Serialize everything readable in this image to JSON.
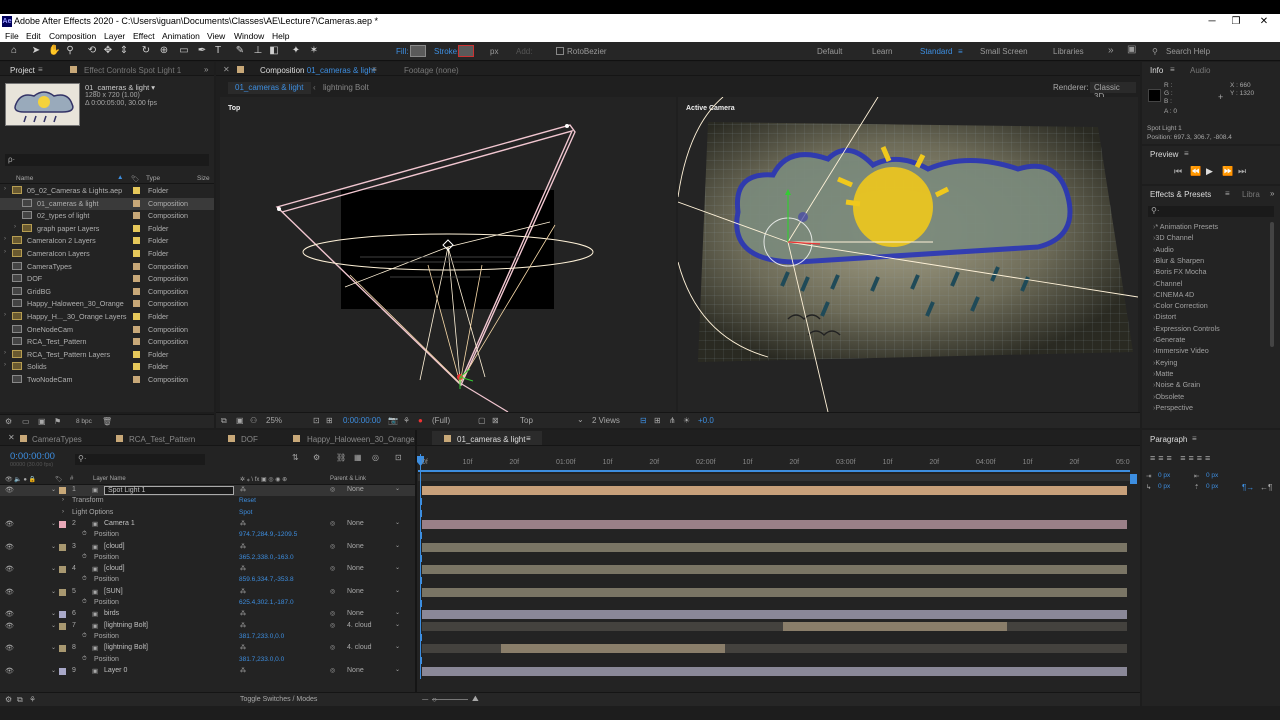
{
  "window": {
    "title": "Adobe After Effects 2020 - C:\\Users\\iguan\\Documents\\Classes\\AE\\Lecture7\\Cameras.aep *"
  },
  "menu": [
    "File",
    "Edit",
    "Composition",
    "Layer",
    "Effect",
    "Animation",
    "View",
    "Window",
    "Help"
  ],
  "toolbar": {
    "fill_label": "Fill:",
    "stroke_label": "Stroke:",
    "px_label": "px",
    "add_label": "Add:",
    "rotobezier": "RotoBezier",
    "workspaces": [
      "Default",
      "Learn",
      "Standard",
      "Small Screen",
      "Libraries"
    ],
    "search_placeholder": "Search Help"
  },
  "project": {
    "tab": "Project",
    "effect_controls_tab": "Effect Controls Spot Light 1",
    "comp_name": "01_cameras & light ▾",
    "comp_info_1": "1280 x 720 (1.00)",
    "comp_info_2": "Δ 0:00:05:00, 30.00 fps",
    "search_placeholder": "ρ·",
    "headers": {
      "name": "Name",
      "type": "Type",
      "size": "Size"
    },
    "items": [
      {
        "name": "05_02_Cameras & Lights.aep",
        "type": "Folder",
        "color": "#e6c85a"
      },
      {
        "name": "01_cameras & light",
        "type": "Composition",
        "color": "#c8a878"
      },
      {
        "name": "02_types of light",
        "type": "Composition",
        "color": "#c8a878"
      },
      {
        "name": "graph paper Layers",
        "type": "Folder",
        "color": "#e6c85a"
      },
      {
        "name": "CameraIcon 2 Layers",
        "type": "Folder",
        "color": "#e6c85a"
      },
      {
        "name": "CameraIcon Layers",
        "type": "Folder",
        "color": "#e6c85a"
      },
      {
        "name": "CameraTypes",
        "type": "Composition",
        "color": "#c8a878"
      },
      {
        "name": "DOF",
        "type": "Composition",
        "color": "#c8a878"
      },
      {
        "name": "GridBG",
        "type": "Composition",
        "color": "#c8a878"
      },
      {
        "name": "Happy_Haloween_30_Orange",
        "type": "Composition",
        "color": "#c8a878"
      },
      {
        "name": "Happy_H..._30_Orange Layers",
        "type": "Folder",
        "color": "#e6c85a"
      },
      {
        "name": "OneNodeCam",
        "type": "Composition",
        "color": "#c8a878"
      },
      {
        "name": "RCA_Test_Pattern",
        "type": "Composition",
        "color": "#c8a878"
      },
      {
        "name": "RCA_Test_Pattern Layers",
        "type": "Folder",
        "color": "#e6c85a"
      },
      {
        "name": "Solids",
        "type": "Folder",
        "color": "#e6c85a"
      },
      {
        "name": "TwoNodeCam",
        "type": "Composition",
        "color": "#c8a878"
      }
    ],
    "bpc": "8 bpc"
  },
  "composition": {
    "tab_prefix": "Composition",
    "tab_name": "01_cameras & light",
    "footage_tab": "Footage (none)",
    "breadcrumbs": [
      "01_cameras & light",
      "lightning Bolt"
    ],
    "renderer_label": "Renderer:",
    "renderer": "Classic 3D",
    "view_left": "Top",
    "view_right": "Active Camera",
    "footer": {
      "zoom": "25%",
      "time": "0:00:00:00",
      "resolution": "(Full)",
      "view": "Top",
      "views": "2 Views",
      "exposure": "+0.0"
    }
  },
  "info": {
    "tab": "Info",
    "audio_tab": "Audio",
    "r": "R :",
    "g": "G :",
    "b": "B :",
    "a": "A : 0",
    "x": "X : 660",
    "y": "Y : 1320",
    "layer": "Spot Light 1",
    "position": "Position: 697.3, 306.7, -808.4"
  },
  "preview": {
    "tab": "Preview"
  },
  "effects": {
    "tab": "Effects & Presets",
    "libraries_tab": "Libra",
    "items": [
      "* Animation Presets",
      "3D Channel",
      "Audio",
      "Blur & Sharpen",
      "Boris FX Mocha",
      "Channel",
      "CINEMA 4D",
      "Color Correction",
      "Distort",
      "Expression Controls",
      "Generate",
      "Immersive Video",
      "Keying",
      "Matte",
      "Noise & Grain",
      "Obsolete",
      "Perspective"
    ]
  },
  "timeline": {
    "tabs": [
      "CameraTypes",
      "RCA_Test_Pattern",
      "DOF",
      "Happy_Haloween_30_Orange",
      "01_cameras & light"
    ],
    "timecode": "0:00:00:00",
    "fps_sub": "00000 (30.00 fps)",
    "col_layer_name": "Layer Name",
    "col_parent": "Parent & Link",
    "ruler": [
      "0f",
      "10f",
      "20f",
      "01:00f",
      "10f",
      "20f",
      "02:00f",
      "10f",
      "20f",
      "03:00f",
      "10f",
      "20f",
      "04:00f",
      "10f",
      "20f",
      "05:0"
    ],
    "toggle_label": "Toggle Switches / Modes",
    "layers": [
      {
        "num": "1",
        "name": "Spot Light 1",
        "kind": "layer",
        "parent": "None",
        "label": "#c8a878",
        "bar": "#c8a07a",
        "start": 0,
        "end": 1,
        "selected": true
      },
      {
        "kind": "prop",
        "name": "Transform",
        "value": "Reset"
      },
      {
        "kind": "prop",
        "name": "Light Options",
        "value": "Spot"
      },
      {
        "num": "2",
        "name": "Camera 1",
        "kind": "layer",
        "parent": "None",
        "label": "#e8a8b8",
        "bar": "#9a8088",
        "start": 0,
        "end": 1
      },
      {
        "kind": "prop",
        "name": "Position",
        "value": "974.7,284.9,-1209.5"
      },
      {
        "num": "3",
        "name": "[cloud]",
        "kind": "layer",
        "parent": "None",
        "label": "#a89870",
        "bar": "#7a7565",
        "start": 0,
        "end": 1
      },
      {
        "kind": "prop",
        "name": "Position",
        "value": "365.2,338.0,-163.0"
      },
      {
        "num": "4",
        "name": "[cloud]",
        "kind": "layer",
        "parent": "None",
        "label": "#a89870",
        "bar": "#7a7565",
        "start": 0,
        "end": 1
      },
      {
        "kind": "prop",
        "name": "Position",
        "value": "859.6,334.7,-353.8"
      },
      {
        "num": "5",
        "name": "[SUN]",
        "kind": "layer",
        "parent": "None",
        "label": "#a89870",
        "bar": "#7a7565",
        "start": 0,
        "end": 1
      },
      {
        "kind": "prop",
        "name": "Position",
        "value": "625.4,302.1,-187.0"
      },
      {
        "num": "6",
        "name": "birds",
        "kind": "layer",
        "parent": "None",
        "label": "#a8a8c8",
        "bar": "#8a8898",
        "start": 0,
        "end": 1
      },
      {
        "num": "7",
        "name": "[lightning Bolt]",
        "kind": "layer",
        "parent": "4. cloud",
        "label": "#a89870",
        "bar": "#8a7e6a",
        "start": 0.512,
        "end": 0.83
      },
      {
        "kind": "prop",
        "name": "Position",
        "value": "381.7,233.0,0.0"
      },
      {
        "num": "8",
        "name": "[lightning Bolt]",
        "kind": "layer",
        "parent": "4. cloud",
        "label": "#a89870",
        "bar": "#8a7e6a",
        "start": 0.112,
        "end": 0.43
      },
      {
        "kind": "prop",
        "name": "Position",
        "value": "381.7,233.0,0.0"
      },
      {
        "num": "9",
        "name": "Layer 0",
        "kind": "layer",
        "parent": "None",
        "label": "#a8a8c8",
        "bar": "#8a8898",
        "start": 0,
        "end": 1
      }
    ]
  },
  "paragraph": {
    "tab": "Paragraph",
    "indent_values": [
      "0 px",
      "0 px",
      "0 px",
      "0 px",
      "0 px"
    ]
  }
}
